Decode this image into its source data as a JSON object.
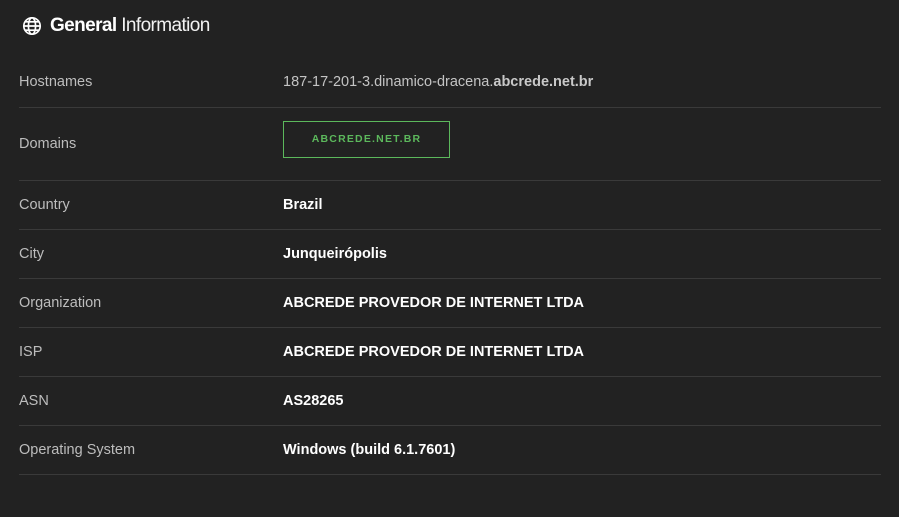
{
  "header": {
    "icon": "globe-icon",
    "title_strong": "General",
    "title_light": "Information"
  },
  "rows": {
    "hostnames": {
      "label": "Hostnames",
      "value_plain": "187-17-201-3.dinamico-dracena.",
      "value_bold": "abcrede.net.br"
    },
    "domains": {
      "label": "Domains",
      "badge": "ABCREDE.NET.BR"
    },
    "country": {
      "label": "Country",
      "value": "Brazil"
    },
    "city": {
      "label": "City",
      "value": "Junqueirópolis"
    },
    "organization": {
      "label": "Organization",
      "value": "ABCREDE PROVEDOR DE INTERNET LTDA"
    },
    "isp": {
      "label": "ISP",
      "value": "ABCREDE PROVEDOR DE INTERNET LTDA"
    },
    "asn": {
      "label": "ASN",
      "value": "AS28265"
    },
    "os": {
      "label": "Operating System",
      "value": "Windows (build 6.1.7601)"
    }
  },
  "colors": {
    "background": "#222222",
    "divider": "#3a3a3a",
    "badge_green": "#5cb85c"
  }
}
